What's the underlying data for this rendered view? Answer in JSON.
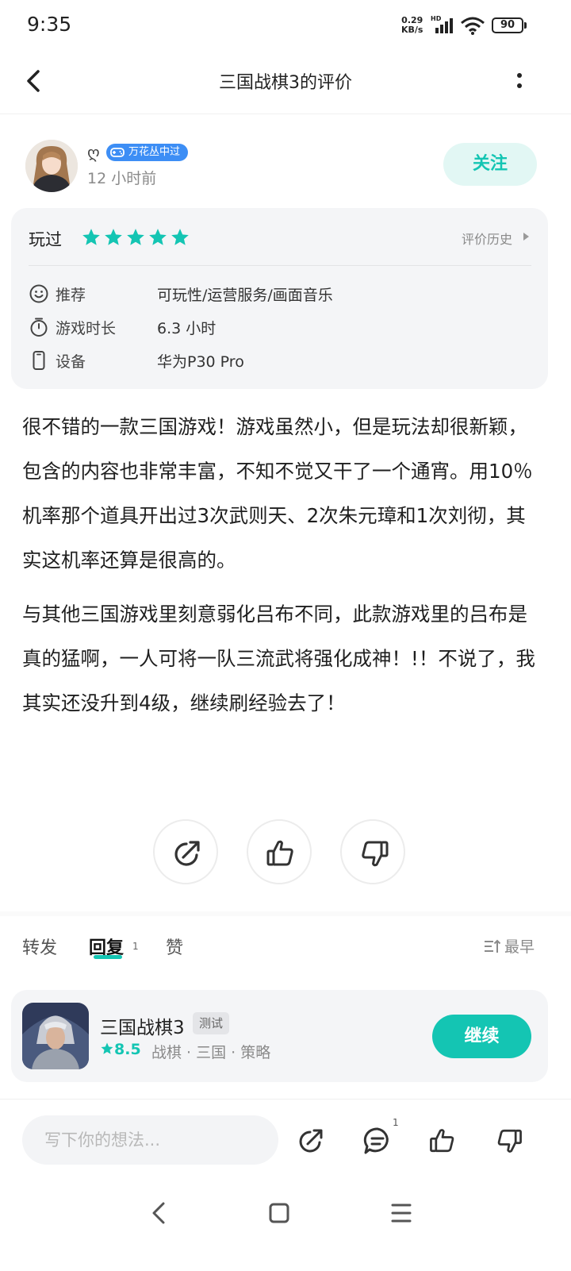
{
  "status_bar": {
    "time": "9:35",
    "net_speed_value": "0.29",
    "net_speed_unit": "KB/s",
    "hd_label": "HD",
    "battery": "90"
  },
  "header": {
    "title": "三国战棋3的评价",
    "back_icon": "chevron-left-icon",
    "more_icon": "more-vertical-icon"
  },
  "author": {
    "name": "ღ",
    "badge": "万花丛中过",
    "time": "12 小时前",
    "follow_label": "关注"
  },
  "review_info": {
    "status": "玩过",
    "rating_stars": 5,
    "history_label": "评价历史",
    "rows": [
      {
        "icon": "smile-icon",
        "label": "推荐",
        "value": "可玩性/运营服务/画面音乐"
      },
      {
        "icon": "stopwatch-icon",
        "label": "游戏时长",
        "value": "6.3 小时"
      },
      {
        "icon": "phone-icon",
        "label": "设备",
        "value": "华为P30 Pro"
      }
    ]
  },
  "review": {
    "paragraphs": [
      "很不错的一款三国游戏！游戏虽然小，但是玩法却很新颖，包含的内容也非常丰富，不知不觉又干了一个通宵。用10％机率那个道具开出过3次武则天、2次朱元璋和1次刘彻，其实这机率还算是很高的。",
      "与其他三国游戏里刻意弱化吕布不同，此款游戏里的吕布是真的猛啊，一人可将一队三流武将强化成神！!！不说了，我其实还没升到4级，继续刷经验去了！"
    ]
  },
  "tabs": {
    "items": [
      {
        "label": "转发"
      },
      {
        "label": "回复",
        "count": "1"
      },
      {
        "label": "赞"
      }
    ],
    "active": "回复",
    "sort_label": "最早"
  },
  "game": {
    "title": "三国战棋3",
    "tag": "测试",
    "rating": "8.5",
    "genres": "战棋 · 三国 · 策略",
    "action_label": "继续"
  },
  "bottom_bar": {
    "placeholder": "写下你的想法...",
    "reply_count": "1"
  },
  "colors": {
    "accent": "#14c5b3",
    "badge": "#3d8ef5",
    "card_bg": "#f4f5f7"
  }
}
